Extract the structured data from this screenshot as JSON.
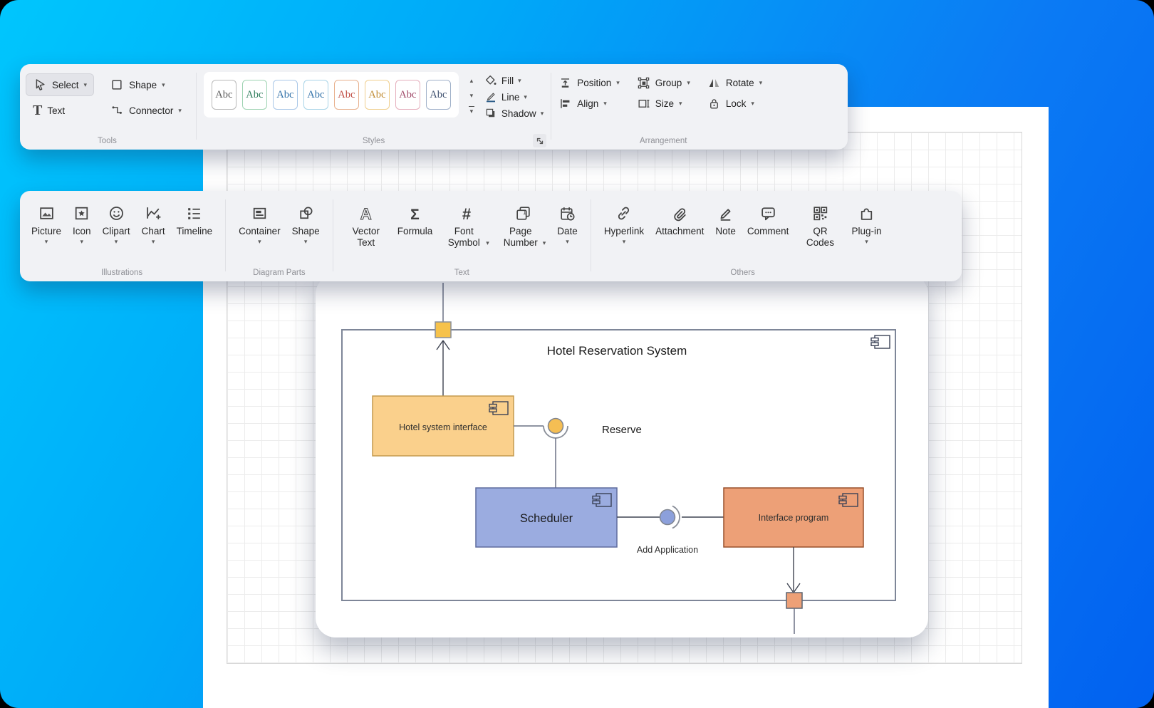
{
  "ribbon1": {
    "tools": {
      "label": "Tools",
      "select": "Select",
      "shape": "Shape",
      "text": "Text",
      "connector": "Connector"
    },
    "styles": {
      "label": "Styles",
      "fill": "Fill",
      "line": "Line",
      "shadow": "Shadow"
    },
    "arrangement": {
      "label": "Arrangement",
      "position": "Position",
      "group": "Group",
      "rotate": "Rotate",
      "align": "Align",
      "size": "Size",
      "lock": "Lock"
    }
  },
  "styles_swatches": [
    {
      "text": "Abc",
      "border": "#b9b9b9",
      "color": "#5a5a5a"
    },
    {
      "text": "Abc",
      "border": "#9ed3b2",
      "color": "#2f7d5c"
    },
    {
      "text": "Abc",
      "border": "#a9c7e8",
      "color": "#2f6fa7"
    },
    {
      "text": "Abc",
      "border": "#a9d4e8",
      "color": "#2f6fa7"
    },
    {
      "text": "Abc",
      "border": "#e8b08c",
      "color": "#bf4b42"
    },
    {
      "text": "Abc",
      "border": "#f0cf8e",
      "color": "#bf8a2f"
    },
    {
      "text": "Abc",
      "border": "#e5aebc",
      "color": "#a04868"
    },
    {
      "text": "Abc",
      "border": "#9fb0c9",
      "color": "#3d4f6e"
    }
  ],
  "ribbon2": {
    "illustrations": {
      "label": "Illustrations",
      "picture": "Picture",
      "icon": "Icon",
      "clipart": "Clipart",
      "chart": "Chart",
      "timeline": "Timeline"
    },
    "diagram_parts": {
      "label": "Diagram Parts",
      "container": "Container",
      "shape": "Shape"
    },
    "text_group": {
      "label": "Text",
      "vector_text": "Vector Text",
      "formula": "Formula",
      "font_symbol": "Font Symbol",
      "page_number": "Page Number",
      "date": "Date"
    },
    "others": {
      "label": "Others",
      "hyperlink": "Hyperlink",
      "attachment": "Attachment",
      "note": "Note",
      "comment": "Comment",
      "qr_codes": "QR Codes",
      "plugin": "Plug-in"
    }
  },
  "diagram": {
    "container_title": "Hotel Reservation System",
    "components": {
      "hotel_system_interface": "Hotel system interface",
      "scheduler": "Scheduler",
      "interface_program": "Interface program"
    },
    "interfaces": {
      "reserve": "Reserve",
      "add_application": "Add Application"
    }
  },
  "colors": {
    "background_gradient_start": "#00c6fd",
    "background_gradient_end": "#0161f0",
    "ribbon_bg": "#f1f2f5",
    "selected_tool_bg": "#e3e4e9",
    "container_stroke": "#7e8698",
    "component_yellow_fill": "#fad08c",
    "component_yellow_stroke": "#c49a4e",
    "component_blue_fill": "#9bace0",
    "component_blue_stroke": "#5e6c9e",
    "component_orange_fill": "#eda077",
    "component_orange_stroke": "#99512c",
    "port_yellow_fill": "#f6c24b",
    "port_orange_fill": "#eda077",
    "port_stroke": "#8a8f99",
    "port_orange_stroke": "#5c6370",
    "ball_yellow_fill": "#f5be53",
    "ball_blue_fill": "#8ca0db",
    "ball_stroke": "#80858f",
    "connector_line": "#6a7184",
    "connector_dark": "#3d4250",
    "uml_icon_stroke": "#3a4156"
  },
  "icons": {
    "caret": "▾",
    "caret_up": "▴",
    "text_tool": "T",
    "vector_text": "A",
    "formula": "Σ",
    "font_symbol": "#",
    "page_number_digit": "1"
  }
}
